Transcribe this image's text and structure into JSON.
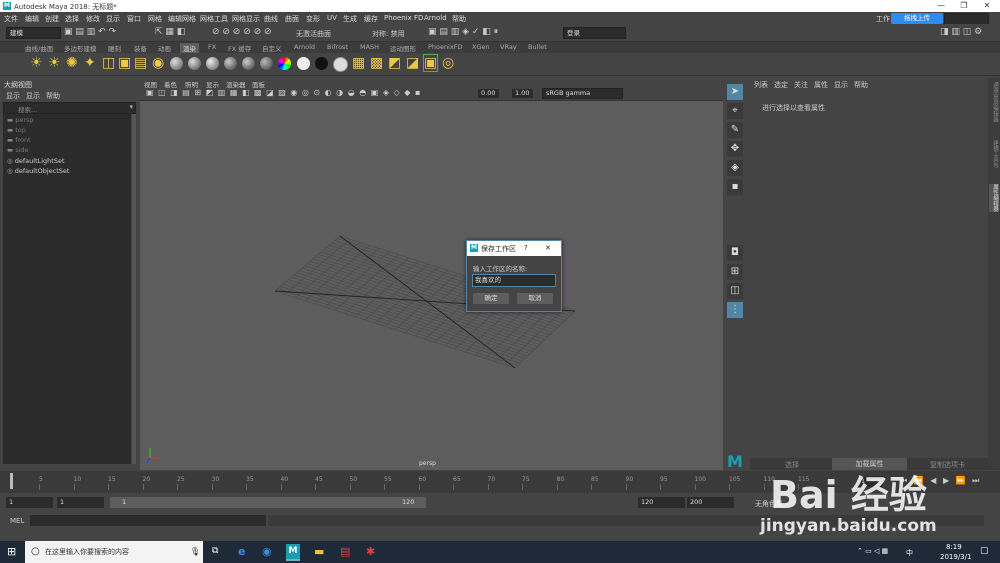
{
  "window": {
    "title": "Autodesk Maya 2018: 无标题*",
    "controls": [
      "—",
      "❐",
      "✕"
    ]
  },
  "menubar": [
    "文件",
    "编辑",
    "创建",
    "选择",
    "修改",
    "显示",
    "窗口",
    "网格",
    "编辑网格",
    "网格工具",
    "网格显示",
    "曲线",
    "曲面",
    "变形",
    "UV",
    "生成",
    "缓存",
    "Phoenix FD",
    "Arnold",
    "帮助"
  ],
  "workspace": {
    "label": "工作",
    "upload_button": "拖拽上传"
  },
  "statusline": {
    "mode": "建模",
    "no_live_surface": "无激活曲面",
    "symmetry": "对称: 禁用",
    "login": "登录"
  },
  "shelf_tabs": [
    "曲线/曲面",
    "多边形建模",
    "雕刻",
    "装备",
    "动画",
    "渲染",
    "FX",
    "FX 缓存",
    "自定义",
    "Arnold",
    "Bifrost",
    "MASH",
    "运动图形",
    "PhoenixFD",
    "XGen",
    "VRay",
    "Bullet"
  ],
  "active_shelf_tab": "渲染",
  "outliner": {
    "title": "大纲视图",
    "menu": [
      "显示",
      "显示",
      "帮助"
    ],
    "search_placeholder": "搜索...",
    "items": [
      "persp",
      "top",
      "front",
      "side",
      "defaultLightSet",
      "defaultObjectSet"
    ]
  },
  "viewport": {
    "menu": [
      "视图",
      "着色",
      "照明",
      "显示",
      "渲染器",
      "面板"
    ],
    "exposure": "0.00",
    "gamma": "1.00",
    "color_space": "sRGB gamma",
    "camera_label": "persp"
  },
  "attribute_editor": {
    "menu": [
      "列表",
      "选定",
      "关注",
      "属性",
      "显示",
      "帮助"
    ],
    "message": "进行选择以查看属性",
    "bottom_buttons": [
      "选择",
      "加载属性",
      "复制选项卡"
    ]
  },
  "side_tabs": [
    "通道盒/层编辑器",
    "建模工具包",
    "属性编辑器"
  ],
  "timeline": {
    "ticks": [
      "5",
      "10",
      "15",
      "20",
      "25",
      "30",
      "35",
      "40",
      "45",
      "50",
      "55",
      "60",
      "65",
      "70",
      "75",
      "80",
      "85",
      "90",
      "95",
      "100",
      "105",
      "110",
      "115"
    ],
    "current_frame": "1"
  },
  "range": {
    "start": "1",
    "playback_start": "1",
    "slider_start": "1",
    "slider_end": "120",
    "playback_end": "120",
    "end": "200",
    "char_set": "无角色集"
  },
  "mel": {
    "label": "MEL"
  },
  "dialog": {
    "title": "保存工作区",
    "help": "?",
    "close": "✕",
    "prompt": "输入工作区的名称:",
    "value": "我喜欢的",
    "ok": "确定",
    "cancel": "取消"
  },
  "taskbar": {
    "search_placeholder": "在这里输入你要搜索的内容",
    "time": "8:19",
    "date": "2019/3/1",
    "lang": "中"
  },
  "watermark": {
    "brand": "Bai 经验",
    "url": "jingyan.baidu.com"
  },
  "colors": {
    "accent": "#5285a6",
    "maya_teal": "#1a9fb0",
    "panel": "#444444",
    "viewport_bg": "#5d5d5d"
  }
}
